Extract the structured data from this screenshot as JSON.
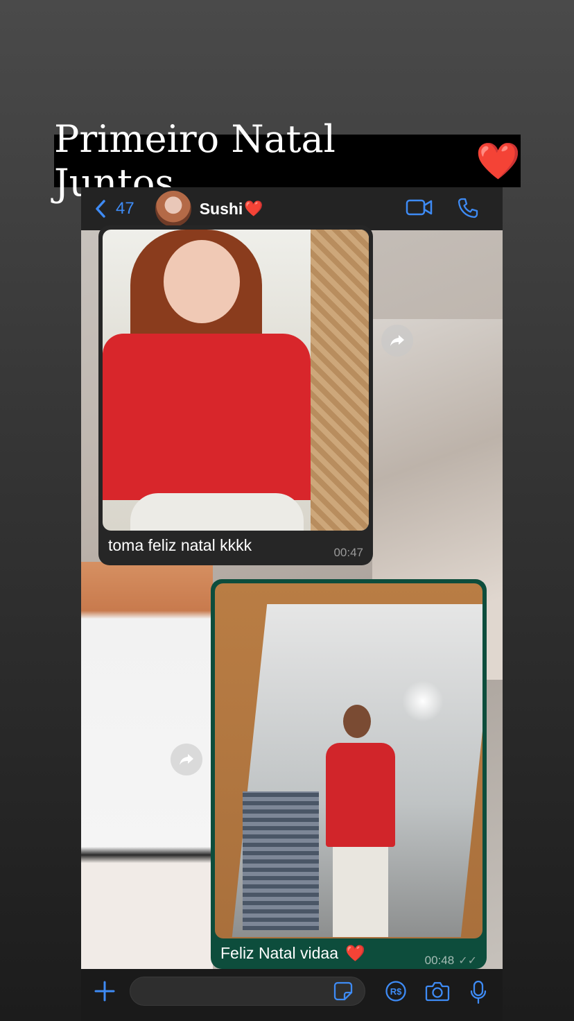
{
  "story": {
    "title": "Primeiro Natal Juntos",
    "title_emoji": "❤️"
  },
  "header": {
    "back_count": "47",
    "contact_name": "Sushi",
    "contact_emoji": "❤️",
    "icons": [
      "chevron-left-icon",
      "video-call-icon",
      "phone-icon"
    ]
  },
  "messages": [
    {
      "direction": "incoming",
      "type": "image",
      "caption": "toma feliz natal kkkk",
      "time": "00:47"
    },
    {
      "direction": "outgoing",
      "type": "image",
      "caption": "Feliz Natal vidaa",
      "caption_emoji": "❤️",
      "time": "00:48",
      "status": "read"
    }
  ],
  "composer": {
    "value": "",
    "placeholder": "",
    "icons": [
      "plus-icon",
      "sticker-icon",
      "pix-payment-icon",
      "camera-icon",
      "microphone-icon"
    ]
  },
  "colors": {
    "accent": "#3e8bf5",
    "outgoing_bubble": "#0d4d3c",
    "incoming_bubble": "#262626",
    "header_bg": "#232323",
    "title_bg": "#000000"
  }
}
